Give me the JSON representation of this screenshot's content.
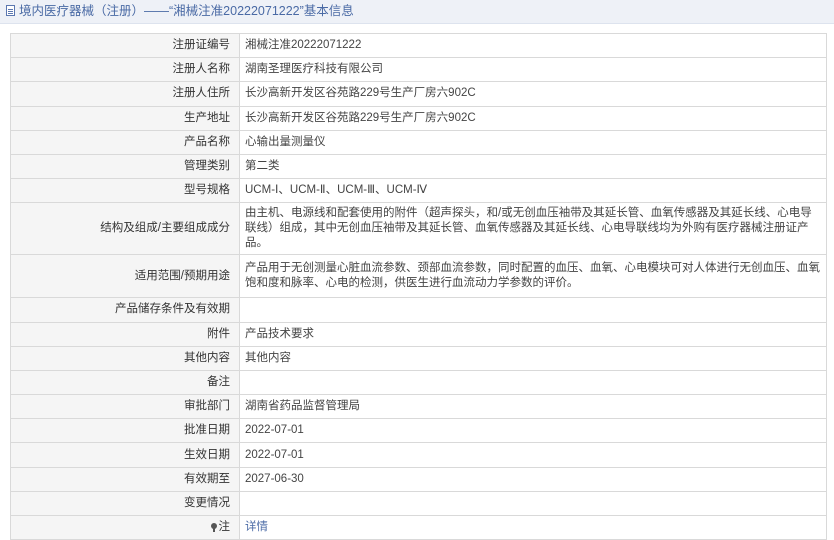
{
  "header": {
    "title": "境内医疗器械（注册）——“湘械注准20222071222”基本信息"
  },
  "rows": [
    {
      "label": "注册证编号",
      "value": "湘械注准20222071222"
    },
    {
      "label": "注册人名称",
      "value": "湖南圣理医疗科技有限公司"
    },
    {
      "label": "注册人住所",
      "value": "长沙高新开发区谷苑路229号生产厂房六902C"
    },
    {
      "label": "生产地址",
      "value": "长沙高新开发区谷苑路229号生产厂房六902C"
    },
    {
      "label": "产品名称",
      "value": "心输出量测量仪"
    },
    {
      "label": "管理类别",
      "value": "第二类"
    },
    {
      "label": "型号规格",
      "value": "UCM-Ⅰ、UCM-Ⅱ、UCM-Ⅲ、UCM-Ⅳ"
    },
    {
      "label": "结构及组成/主要组成成分",
      "value": "由主机、电源线和配套使用的附件（超声探头，和/或无创血压袖带及其延长管、血氧传感器及其延长线、心电导联线）组成，其中无创血压袖带及其延长管、血氧传感器及其延长线、心电导联线均为外购有医疗器械注册证产品。"
    },
    {
      "label": "适用范围/预期用途",
      "value": "产品用于无创测量心脏血流参数、颈部血流参数，同时配置的血压、血氧、心电模块可对人体进行无创血压、血氧饱和度和脉率、心电的检测，供医生进行血流动力学参数的评价。"
    },
    {
      "label": "产品储存条件及有效期",
      "value": ""
    },
    {
      "label": "附件",
      "value": "产品技术要求"
    },
    {
      "label": "其他内容",
      "value": "其他内容"
    },
    {
      "label": "备注",
      "value": ""
    },
    {
      "label": "审批部门",
      "value": "湖南省药品监督管理局"
    },
    {
      "label": "批准日期",
      "value": "2022-07-01"
    },
    {
      "label": "生效日期",
      "value": "2022-07-01"
    },
    {
      "label": "有效期至",
      "value": "2027-06-30"
    },
    {
      "label": "变更情况",
      "value": ""
    }
  ],
  "note_row": {
    "label": "注",
    "link_text": "详情"
  }
}
